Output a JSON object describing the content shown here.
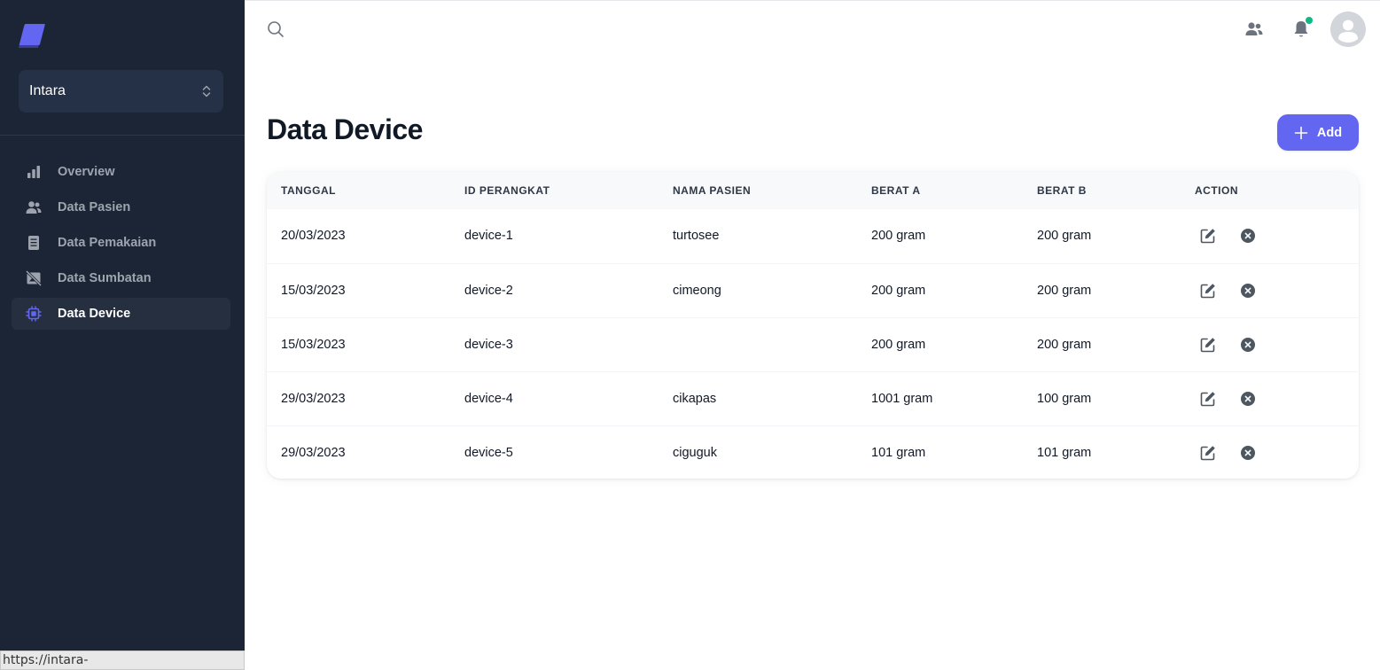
{
  "sidebar": {
    "org_name": "Intara",
    "items": [
      {
        "label": "Overview",
        "icon": "bar-chart-icon",
        "active": false
      },
      {
        "label": "Data Pasien",
        "icon": "users-icon",
        "active": false
      },
      {
        "label": "Data Pemakaian",
        "icon": "receipt-icon",
        "active": false
      },
      {
        "label": "Data Sumbatan",
        "icon": "no-image-icon",
        "active": false
      },
      {
        "label": "Data Device",
        "icon": "chip-icon",
        "active": true
      }
    ]
  },
  "status_bar": {
    "url": "https://intara-iot.vercel.app/perangkat"
  },
  "header": {
    "notification_dot": true
  },
  "page": {
    "title": "Data Device",
    "add_label": "Add"
  },
  "table": {
    "columns": [
      "TANGGAL",
      "ID PERANGKAT",
      "NAMA PASIEN",
      "BERAT A",
      "BERAT B",
      "ACTION"
    ],
    "rows": [
      {
        "tanggal": "20/03/2023",
        "id": "device-1",
        "nama": "turtosee",
        "berat_a": "200 gram",
        "berat_b": "200 gram"
      },
      {
        "tanggal": "15/03/2023",
        "id": "device-2",
        "nama": "cimeong",
        "berat_a": "200 gram",
        "berat_b": "200 gram"
      },
      {
        "tanggal": "15/03/2023",
        "id": "device-3",
        "nama": "",
        "berat_a": "200 gram",
        "berat_b": "200 gram"
      },
      {
        "tanggal": "29/03/2023",
        "id": "device-4",
        "nama": "cikapas",
        "berat_a": "1001 gram",
        "berat_b": "100 gram"
      },
      {
        "tanggal": "29/03/2023",
        "id": "device-5",
        "nama": "ciguguk",
        "berat_a": "101 gram",
        "berat_b": "101 gram"
      }
    ]
  },
  "colors": {
    "sidebar_bg": "#1c2536",
    "accent": "#6366f1",
    "status_dot": "#10b981"
  }
}
